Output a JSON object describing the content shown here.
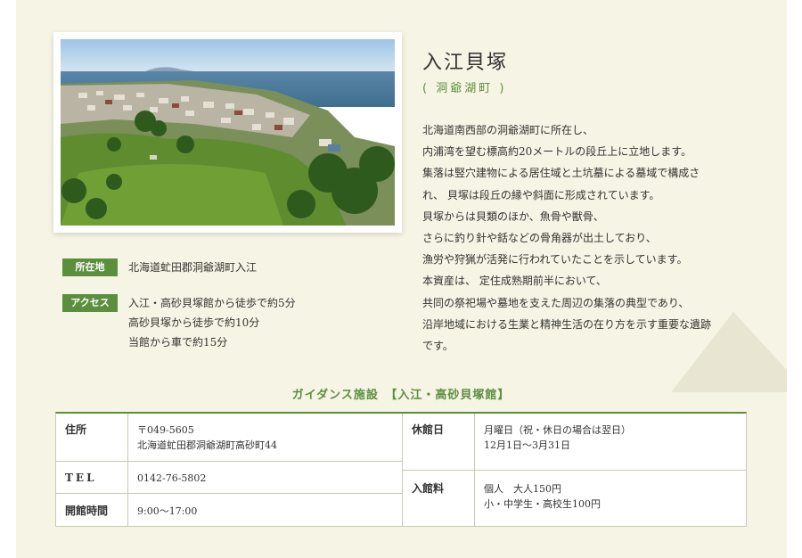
{
  "site": {
    "title": "入江貝塚",
    "subtitle": "( 洞爺湖町 )",
    "photo_alt": "",
    "location_label": "所在地",
    "location_value": "北海道虻田郡洞爺湖町入江",
    "access_label": "アクセス",
    "access_lines": [
      "入江・高砂貝塚館から徒歩で約5分",
      "高砂貝塚から徒歩で約10分",
      "当館から車で約15分"
    ],
    "description": [
      "北海道南西部の洞爺湖町に所在し、",
      "内浦湾を望む標高約20メートルの段丘上に立地します。",
      "集落は竪穴建物による居住域と土坑墓による墓域で構成さ",
      "れ、 貝塚は段丘の縁や斜面に形成されています。",
      "貝塚からは貝類のほか、魚骨や獣骨、",
      "さらに釣り針や銛などの骨角器が出土しており、",
      "漁労や狩猟が活発に行われていたことを示しています。",
      "本資産は、 定住成熟期前半において、",
      "共同の祭祀場や墓地を支えた周辺の集落の典型であり、",
      "沿岸地域における生業と精神生活の在り方を示す重要な遺跡",
      "です。"
    ]
  },
  "guidance": {
    "title": "ガイダンス施設　【入江・高砂貝塚館】",
    "address_label": "住所",
    "address_lines": [
      "〒049-5605",
      "北海道虻田郡洞爺湖町高砂町44"
    ],
    "tel_label": "TEL",
    "tel_value": "0142-76-5802",
    "hours_label": "開館時間",
    "hours_value": "9:00～17:00",
    "closed_label": "休館日",
    "closed_lines": [
      "月曜日（祝・休日の場合は翌日）",
      "12月1日～3月31日"
    ],
    "fee_label": "入館料",
    "fee_lines": [
      "個人　大人150円",
      "小・中学生・高校生100円"
    ]
  },
  "colors": {
    "accent": "#5b8f3d",
    "panel_bg": "#f6f4e4"
  }
}
